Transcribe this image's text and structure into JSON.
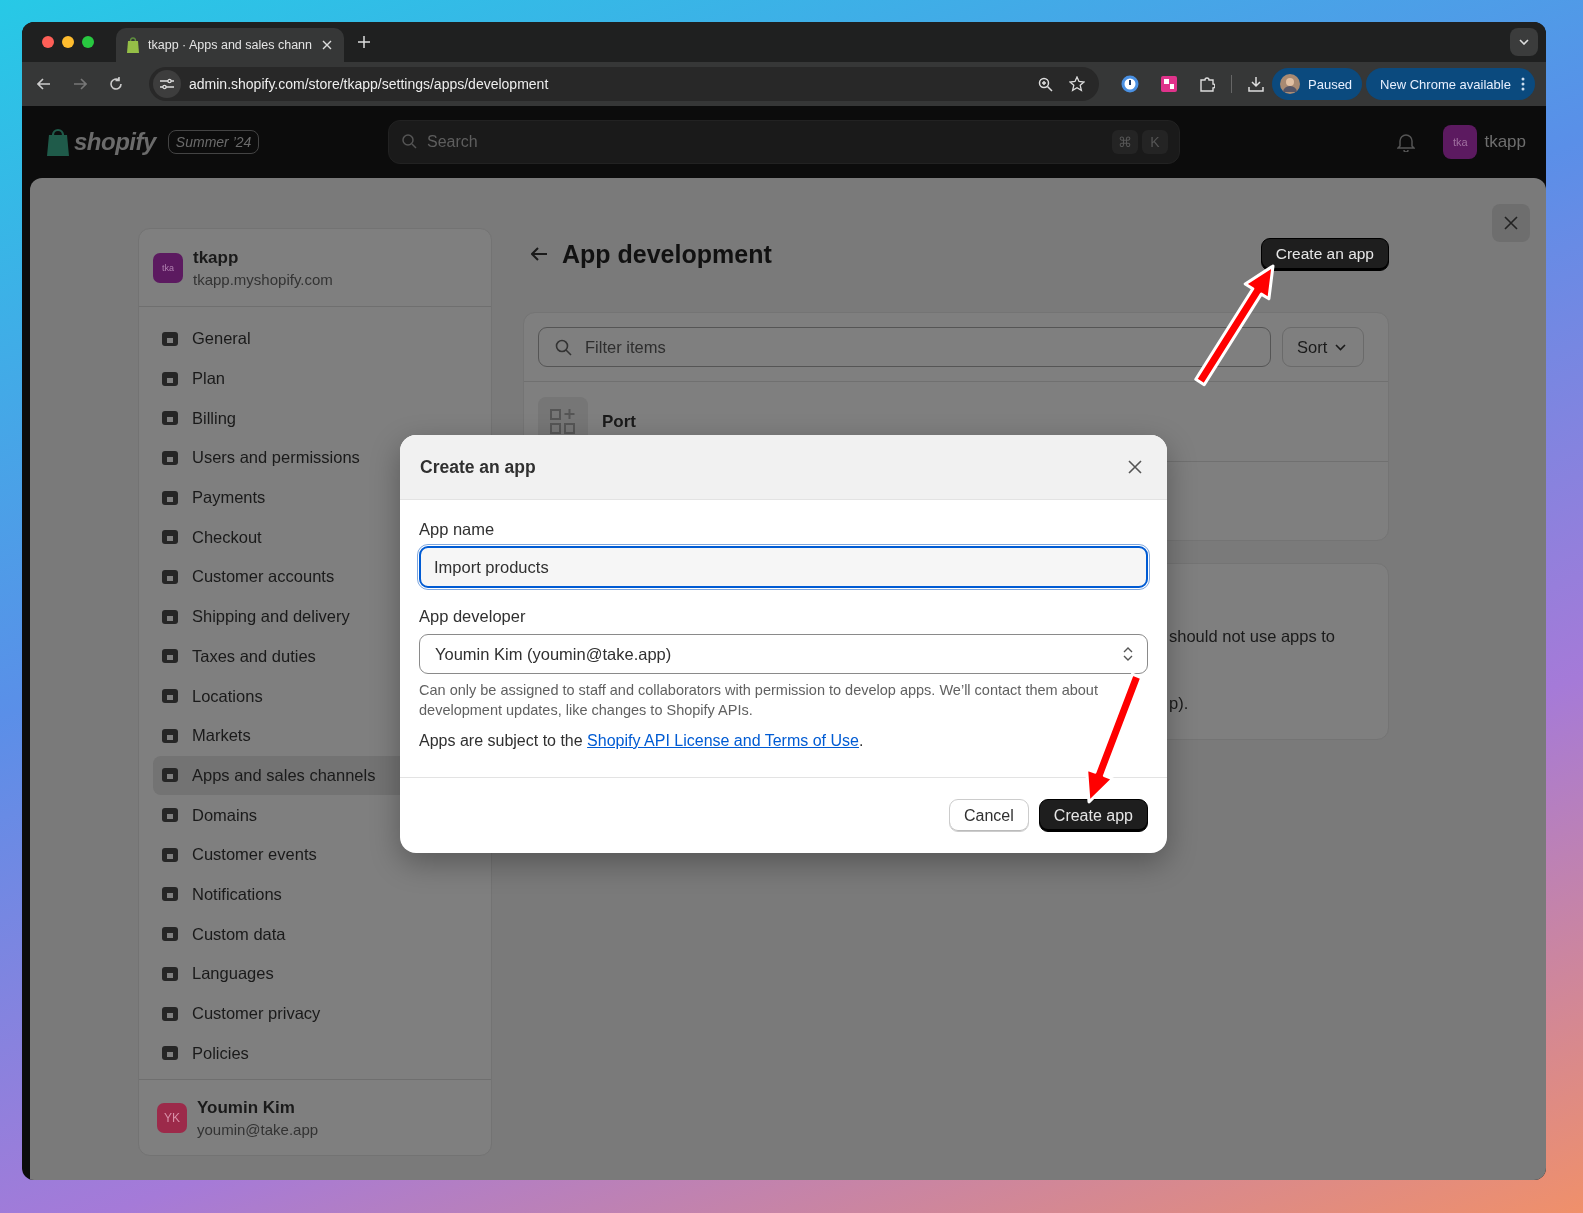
{
  "browser": {
    "tab": {
      "title": "tkapp · Apps and sales chann"
    },
    "url": "admin.shopify.com/store/tkapp/settings/apps/development",
    "profile": "Paused",
    "update": "New Chrome available"
  },
  "header": {
    "logo": "shopify",
    "badge": "Summer ’24",
    "search": {
      "placeholder": "Search"
    },
    "shortcut": [
      "⌘",
      "K"
    ],
    "store_avatar": "tka",
    "store_name": "tkapp"
  },
  "sidebar": {
    "store": {
      "avatar": "tka",
      "name": "tkapp",
      "domain": "tkapp.myshopify.com"
    },
    "items": [
      {
        "label": "General",
        "selected": false
      },
      {
        "label": "Plan",
        "selected": false
      },
      {
        "label": "Billing",
        "selected": false
      },
      {
        "label": "Users and permissions",
        "selected": false
      },
      {
        "label": "Payments",
        "selected": false
      },
      {
        "label": "Checkout",
        "selected": false
      },
      {
        "label": "Customer accounts",
        "selected": false
      },
      {
        "label": "Shipping and delivery",
        "selected": false
      },
      {
        "label": "Taxes and duties",
        "selected": false
      },
      {
        "label": "Locations",
        "selected": false
      },
      {
        "label": "Markets",
        "selected": false
      },
      {
        "label": "Apps and sales channels",
        "selected": true
      },
      {
        "label": "Domains",
        "selected": false
      },
      {
        "label": "Customer events",
        "selected": false
      },
      {
        "label": "Notifications",
        "selected": false
      },
      {
        "label": "Custom data",
        "selected": false
      },
      {
        "label": "Languages",
        "selected": false
      },
      {
        "label": "Customer privacy",
        "selected": false
      },
      {
        "label": "Policies",
        "selected": false
      }
    ],
    "user": {
      "avatar": "YK",
      "name": "Youmin Kim",
      "email": "youmin@take.app"
    }
  },
  "main": {
    "title": "App development",
    "create_button": "Create an app",
    "filter": {
      "placeholder": "Filter items"
    },
    "sort": "Sort",
    "apps": [
      {
        "name": "Port"
      }
    ],
    "notice": {
      "line_1": "should not use apps to",
      "line_2": "p)."
    }
  },
  "modal": {
    "title": "Create an app",
    "name_label": "App name",
    "name_value": "Import products",
    "developer_label": "App developer",
    "developer_value": "Youmin Kim (youmin@take.app)",
    "help": "Can only be assigned to staff and collaborators with permission to develop apps. We’ll contact them about development updates, like changes to Shopify APIs.",
    "terms_before": "Apps are subject to the ",
    "terms_link": "Shopify API License and Terms of Use",
    "terms_after": ".",
    "buttons": [
      {
        "label": "Cancel",
        "kind": "secondary"
      },
      {
        "label": "Create app",
        "kind": "primary"
      }
    ]
  }
}
